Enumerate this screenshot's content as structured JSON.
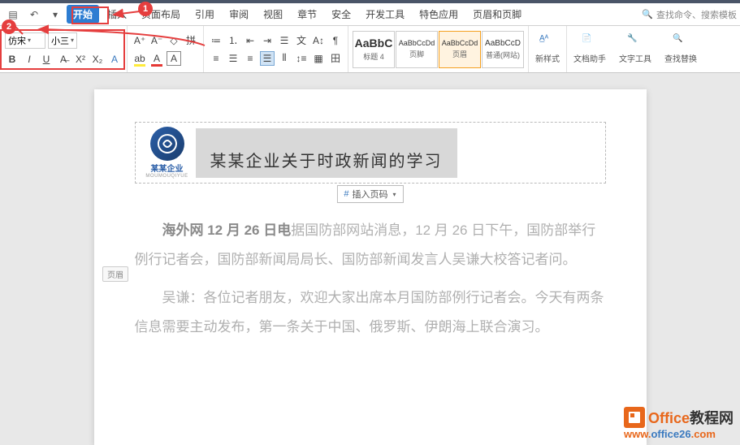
{
  "menu": {
    "start": "开始",
    "insert": "插入",
    "layout": "页面布局",
    "reference": "引用",
    "review": "审阅",
    "view": "视图",
    "section": "章节",
    "security": "安全",
    "devtools": "开发工具",
    "special": "特色应用",
    "headerfooter": "页眉和页脚",
    "search_placeholder": "查找命令、搜索模板"
  },
  "font": {
    "name": "仿宋",
    "size": "小三"
  },
  "styles": [
    {
      "preview": "AaBbC",
      "name": "标题 4",
      "previewSize": "14px"
    },
    {
      "preview": "AaBbCcDd",
      "name": "页脚",
      "previewSize": "9px"
    },
    {
      "preview": "AaBbCcDd",
      "name": "页眉",
      "previewSize": "9px"
    },
    {
      "preview": "AaBbCcD",
      "name": "普通(网站)",
      "previewSize": "10px"
    }
  ],
  "tools": {
    "newstyle": "新样式",
    "dochelp": "文档助手",
    "texttool": "文字工具",
    "findreplace": "查找替换"
  },
  "badges": {
    "b1": "1",
    "b2": "2"
  },
  "header": {
    "tag": "页眉",
    "logo_name": "某某企业",
    "logo_sub": "MOUMOUQIYUE",
    "title": "某某企业关于时政新闻的学习",
    "insert_pagenum": "插入页码"
  },
  "body": {
    "p1a": "海外网 12 月 26 日电",
    "p1b": "据国防部网站消息，12 月 26 日下午，国防部举行例行记者会，国防部新闻局局长、国防部新闻发言人吴谦大校答记者问。",
    "p2": "吴谦：各位记者朋友，欢迎大家出席本月国防部例行记者会。今天有两条信息需要主动发布，第一条关于中国、俄罗斯、伊朗海上联合演习。"
  },
  "watermark": {
    "brand1": "Office",
    "brand2": "教程网",
    "url1": "www.",
    "url2": "office26",
    "url3": ".com"
  }
}
